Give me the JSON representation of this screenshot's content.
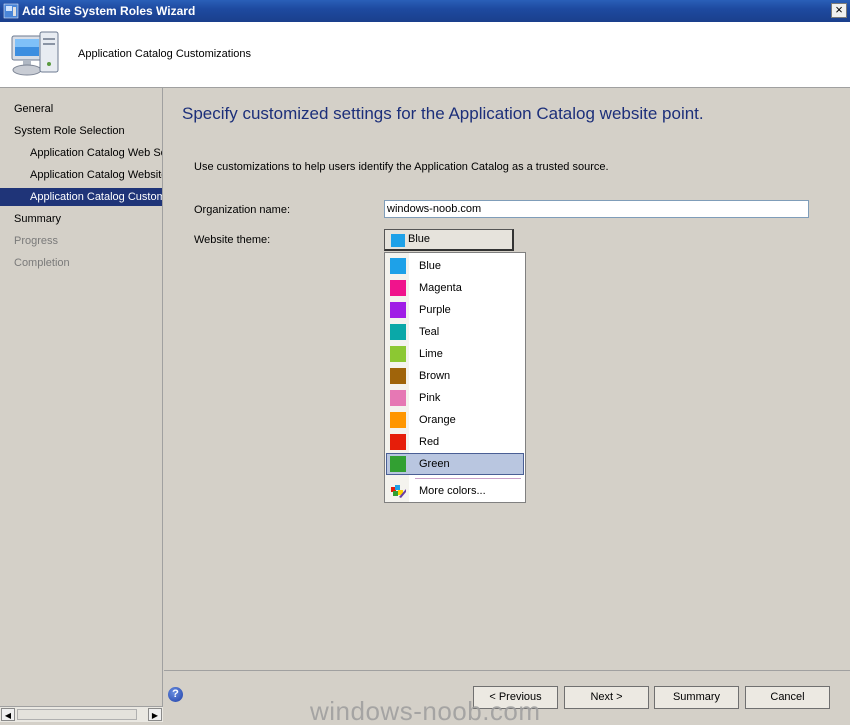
{
  "window": {
    "title": "Add Site System Roles Wizard",
    "close_glyph": "×"
  },
  "header": {
    "title": "Application Catalog Customizations"
  },
  "nav": {
    "items": [
      {
        "label": "General",
        "level": 1,
        "state": "normal"
      },
      {
        "label": "System Role Selection",
        "level": 1,
        "state": "normal"
      },
      {
        "label": "Application Catalog Web Se",
        "level": 2,
        "state": "normal"
      },
      {
        "label": "Application Catalog Website",
        "level": 2,
        "state": "normal"
      },
      {
        "label": "Application Catalog Customi",
        "level": 2,
        "state": "selected"
      },
      {
        "label": "Summary",
        "level": 1,
        "state": "normal"
      },
      {
        "label": "Progress",
        "level": 1,
        "state": "disabled"
      },
      {
        "label": "Completion",
        "level": 1,
        "state": "disabled"
      }
    ],
    "scroll_left": "◀",
    "scroll_right": "▶"
  },
  "main": {
    "heading": "Specify customized settings for the Application Catalog website point.",
    "intro": "Use customizations to help users identify the Application Catalog as a trusted source.",
    "org_label": "Organization name:",
    "org_value": "windows-noob.com",
    "theme_label": "Website theme:",
    "theme_value": "Blue",
    "theme_color": "#1ea1e8"
  },
  "dropdown": {
    "items": [
      {
        "label": "Blue",
        "color": "#1ea1e8"
      },
      {
        "label": "Magenta",
        "color": "#f0148c"
      },
      {
        "label": "Purple",
        "color": "#a01ee6"
      },
      {
        "label": "Teal",
        "color": "#0aa8a8"
      },
      {
        "label": "Lime",
        "color": "#8cc832"
      },
      {
        "label": "Brown",
        "color": "#a0640a"
      },
      {
        "label": "Pink",
        "color": "#e678b4"
      },
      {
        "label": "Orange",
        "color": "#ff9600"
      },
      {
        "label": "Red",
        "color": "#e61e0a"
      },
      {
        "label": "Green",
        "color": "#32a032"
      }
    ],
    "hover_index": 9,
    "more_label": "More colors..."
  },
  "footer": {
    "help_glyph": "?",
    "prev_label": "< Previous",
    "next_label": "Next >",
    "summary_label": "Summary",
    "cancel_label": "Cancel"
  },
  "watermark": "windows-noob.com"
}
